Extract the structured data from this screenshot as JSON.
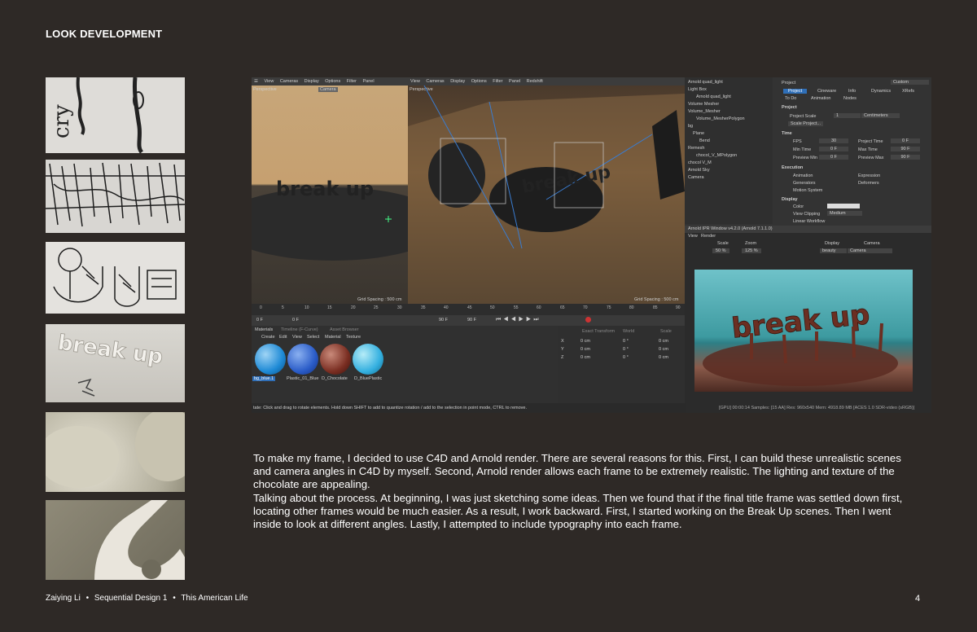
{
  "page": {
    "title": "LOOK DEVELOPMENT",
    "body_paragraphs": [
      "To make my frame, I decided to use C4D and Arnold render. There are several reasons for this. First, I can build these unrealistic scenes and camera angles in C4D by myself. Second, Arnold render allows each frame to be extremely realistic. The lighting and texture of the chocolate are appealing.",
      "Talking about the process. At beginning, I was just sketching some ideas. Then we found that if the final title frame was settled down first, locating other frames would be much easier. As a result, I work backward. First, I started working on the Break Up scenes. Then I went inside to look at different angles. Lastly, I attempted to include typography into each frame."
    ],
    "footer": {
      "author": "Zaiying Li",
      "course": "Sequential Design 1",
      "project": "This American Life",
      "sep": "•"
    },
    "page_number": "4"
  },
  "c4d": {
    "view_menu": [
      "View",
      "Cameras",
      "Display",
      "Options",
      "Filter",
      "Panel",
      "Redshift"
    ],
    "view_menu_left": [
      "View",
      "Cameras",
      "Display",
      "Options",
      "Filter",
      "Panel"
    ],
    "perspective": "Perspective",
    "camera_tag": "Camera",
    "grid_spacing": "Grid Spacing : 500 cm",
    "object_tree": [
      "Arnold quad_light",
      "Light Box",
      "Arnold quad_light",
      "Volume Mesher",
      "Volume_Mesher",
      "Volume_MesherPolygon",
      "bg",
      "Plane",
      "Bend",
      "Remesh",
      "chocol_V_MPolygon",
      "chocol V_M",
      "Arnold Sky",
      "Camera"
    ],
    "timeline_ticks": [
      "0",
      "5",
      "10",
      "15",
      "20",
      "25",
      "30",
      "35",
      "40",
      "45",
      "50",
      "55",
      "60",
      "65",
      "70",
      "75",
      "80",
      "85",
      "90"
    ],
    "frame_fields": [
      "0 F",
      "0 F",
      "90 F",
      "90 F"
    ],
    "materials_tabs": [
      "Materials",
      "Timeline (F-Curve)",
      "Asset Browser"
    ],
    "materials_menu": [
      "Create",
      "Edit",
      "View",
      "Select",
      "Material",
      "Texture"
    ],
    "materials": [
      "bg_blue.1",
      "Plastic_01_Blue",
      "D_Chocolate",
      "D_BluePlastic"
    ],
    "coord_headers": [
      "Exact Transform",
      "World",
      "Scale"
    ],
    "coords": [
      {
        "axis": "X",
        "pos": "0 cm",
        "rot": "0 °",
        "scale": "0 cm"
      },
      {
        "axis": "Y",
        "pos": "0 cm",
        "rot": "0 °",
        "scale": "0 cm"
      },
      {
        "axis": "Z",
        "pos": "0 cm",
        "rot": "0 °",
        "scale": "0 cm"
      }
    ],
    "status_bar": "tate: Click and drag to rotate elements. Hold down SHIFT to add to quantize rotation / add to the selection in point mode, CTRL to remove.",
    "attributes": {
      "header": "Project",
      "mode": "Custom",
      "tabs": [
        "Project",
        "Cineware",
        "Info",
        "Dynamics",
        "XRefs"
      ],
      "subtabs": [
        "To Do",
        "Animation",
        "Nodes"
      ],
      "section_project": "Project",
      "project_scale_label": "Project Scale",
      "project_scale_value": "1",
      "project_scale_unit": "Centimeters",
      "scale_project_button": "Scale Project...",
      "section_time": "Time",
      "fps_label": "FPS",
      "fps_value": "30",
      "project_time_label": "Project Time",
      "project_time_value": "0 F",
      "min_time_label": "Min Time",
      "min_time_value": "0 F",
      "max_time_label": "Max Time",
      "max_time_value": "90 F",
      "preview_min_label": "Preview Min",
      "preview_min_value": "0 F",
      "preview_max_label": "Preview Max",
      "preview_max_value": "90 F",
      "section_execution": "Execution",
      "animation_label": "Animation",
      "expression_label": "Expression",
      "generators_label": "Generators",
      "deformers_label": "Deformers",
      "motion_system_label": "Motion System",
      "section_display": "Display",
      "color_label": "Color",
      "view_clipping_label": "View Clipping",
      "view_clipping_value": "Medium",
      "linear_workflow_label": "Linear Workflow"
    },
    "ipr": {
      "title": "Arnold IPR Window v4.2.0 (Arnold 7.1.1.0)",
      "menu": [
        "View",
        "Render"
      ],
      "scale_label": "Scale",
      "scale_value": "50 %",
      "zoom_label": "Zoom",
      "zoom_value": "125 %",
      "display_label": "Display",
      "display_value": "beauty",
      "camera_label": "Camera",
      "camera_value": "Camera",
      "status": "[GPU] 00:00:14  Samples: [15 AA]  Res: 960x540  Mem: 4918.89 MB  [ACES 1.0 SDR-video (sRGB)]",
      "render_text": "break up"
    },
    "viewport_text": "break up"
  },
  "thumbnail_text": {
    "sketch1": "cry",
    "render": "break up"
  },
  "colors": {
    "page_bg": "#2e2926",
    "ui_panel": "#353535",
    "ui_selection": "#2f6fb8",
    "chocolate": "#6b2f22",
    "render_bg": "#3fa3a8"
  }
}
